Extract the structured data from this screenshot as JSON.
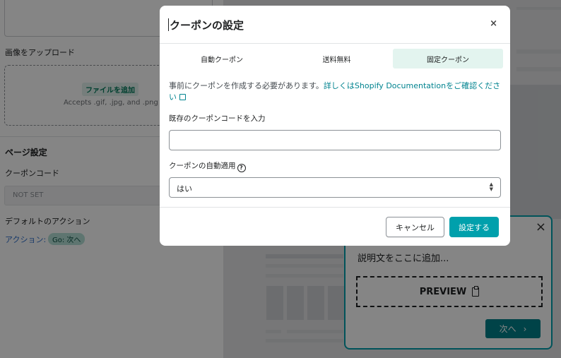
{
  "background": {
    "image_label": "画像をアップロード",
    "add_file": "ファイルを追加",
    "accepts": "Accepts .gif, .jpg, and .png",
    "page_settings_title": "ページ設定",
    "coupon_code_label": "クーポンコード",
    "coupon_code_value": "NOT SET",
    "default_action_label": "デフォルトのアクション",
    "action_label": "アクション:",
    "action_badge": "Go: 次へ"
  },
  "preview_card": {
    "close": "×",
    "description": "説明文をここに追加...",
    "preview_label": "PREVIEW",
    "next_label": "次へ",
    "next_arrow": "›",
    "border_color": "#00a0ac"
  },
  "modal": {
    "title": "クーポンの設定",
    "close": "×",
    "tabs": [
      {
        "label": "自動クーポン",
        "active": false
      },
      {
        "label": "送料無料",
        "active": false
      },
      {
        "label": "固定クーポン",
        "active": true
      }
    ],
    "info_text": "事前にクーポンを作成する必要があります。",
    "info_link": "詳しくはShopify Documentationをご確認ください",
    "code_field_label": "既存のクーポンコードを入力",
    "code_field_value": "",
    "auto_apply_label": "クーポンの自動適用",
    "auto_apply_value": "はい",
    "cancel_label": "キャンセル",
    "save_label": "設定する",
    "accent_color": "#00a0ac"
  }
}
